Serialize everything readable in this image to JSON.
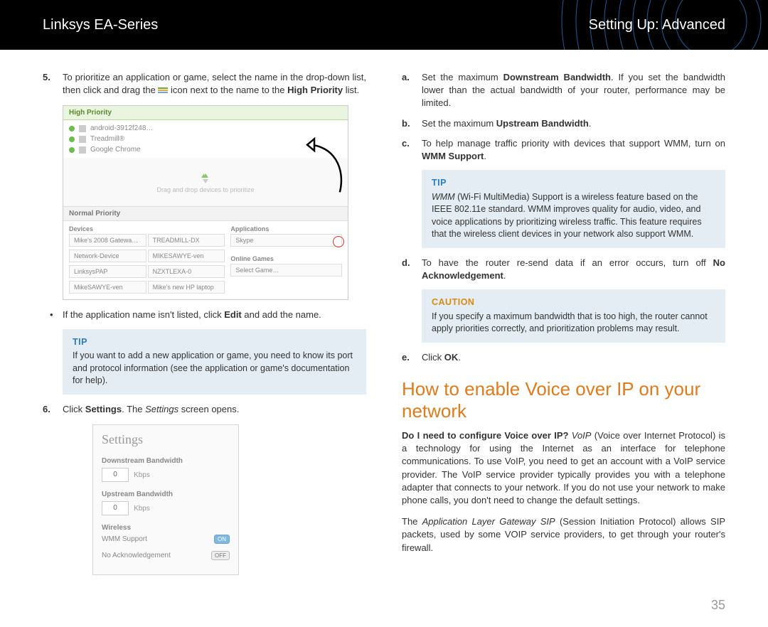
{
  "header": {
    "left": "Linksys EA-Series",
    "right": "Setting Up: Advanced"
  },
  "left_col": {
    "step5_num": "5.",
    "step5_a": "To prioritize an application or game, select the name in the drop-down list, then click and drag the ",
    "step5_b": " icon next to the name to the ",
    "step5_bold": "High Priority",
    "step5_c": " list.",
    "shot1": {
      "hp_title": "High Priority",
      "rows": [
        "android-3912f248…",
        "Treadmill®",
        "Google Chrome"
      ],
      "drag_hint": "Drag and drop devices to prioritize",
      "np_title": "Normal Priority",
      "devices_lbl": "Devices",
      "apps_lbl": "Applications",
      "online_lbl": "Online Games",
      "devices": [
        "Mike's 2008 Gatewa…",
        "TREADMILL-DX",
        "Network-Device",
        "MIKESAWYE-ven",
        "LinksysPAP",
        "NZXTLEXA-0",
        "MikeSAWYE-ven",
        "Mike's new HP laptop"
      ],
      "app_val": "Skype",
      "game_val": "Select Game…"
    },
    "bullet1_a": "If the application name isn't listed, click ",
    "bullet1_bold": "Edit",
    "bullet1_b": " and add the name.",
    "tip1_label": "TIP",
    "tip1_body": "If you want to add a new application or game, you need to know its port and protocol information (see the application or game's documentation for help).",
    "step6_num": "6.",
    "step6_a": "Click ",
    "step6_bold": "Settings",
    "step6_b": ". The ",
    "step6_em": "Settings",
    "step6_c": " screen opens.",
    "shot2": {
      "title": "Settings",
      "down_lbl": "Downstream Bandwidth",
      "down_val": "0",
      "up_lbl": "Upstream Bandwidth",
      "up_val": "0",
      "unit": "Kbps",
      "wireless_lbl": "Wireless",
      "wmm_lbl": "WMM Support",
      "wmm_val": "ON",
      "noack_lbl": "No Acknowledgement",
      "noack_val": "OFF"
    }
  },
  "right_col": {
    "a_num": "a.",
    "a_a": "Set the maximum ",
    "a_bold": "Downstream Bandwidth",
    "a_b": ". If you set the bandwidth lower than the actual bandwidth of your router, performance may be limited.",
    "b_num": "b.",
    "b_a": "Set the maximum ",
    "b_bold": "Upstream Bandwidth",
    "b_b": ".",
    "c_num": "c.",
    "c_a": "To help manage traffic priority with devices that support WMM, turn on ",
    "c_bold": "WMM Support",
    "c_b": ".",
    "tip2_label": "TIP",
    "tip2_body_em": "WMM",
    "tip2_body": " (Wi-Fi MultiMedia) Support is a wireless feature based on the IEEE 802.11e standard. WMM improves quality for audio, video, and voice applications by prioritizing wireless traffic. This feature requires that the wireless client devices in your network also support WMM.",
    "d_num": "d.",
    "d_a": "To have the router re-send data if an error occurs, turn off ",
    "d_bold": "No Acknowledgement",
    "d_b": ".",
    "caution_label": "CAUTION",
    "caution_body": "If you specify a maximum bandwidth that is too high, the router cannot apply priorities correctly, and prioritization problems may result.",
    "e_num": "e.",
    "e_a": "Click ",
    "e_bold": "OK",
    "e_b": ".",
    "h2": "How to enable Voice over IP on your network",
    "p1_bold": "Do I need to configure Voice over IP?",
    "p1_em": " VoIP",
    "p1": " (Voice over Internet Protocol) is a technology for using the Internet as an interface for telephone communications. To use VoIP, you need to get an account with a VoIP service provider. The VoIP service provider typically provides you with a telephone adapter that connects to your network. If you do not use your network to make phone calls, you don't need to change the default settings.",
    "p2_a": "The ",
    "p2_em": "Application Layer Gateway SIP",
    "p2_b": " (Session Initiation Protocol) allows SIP packets, used by some VOIP service providers, to get through your router's firewall."
  },
  "pagenum": "35"
}
